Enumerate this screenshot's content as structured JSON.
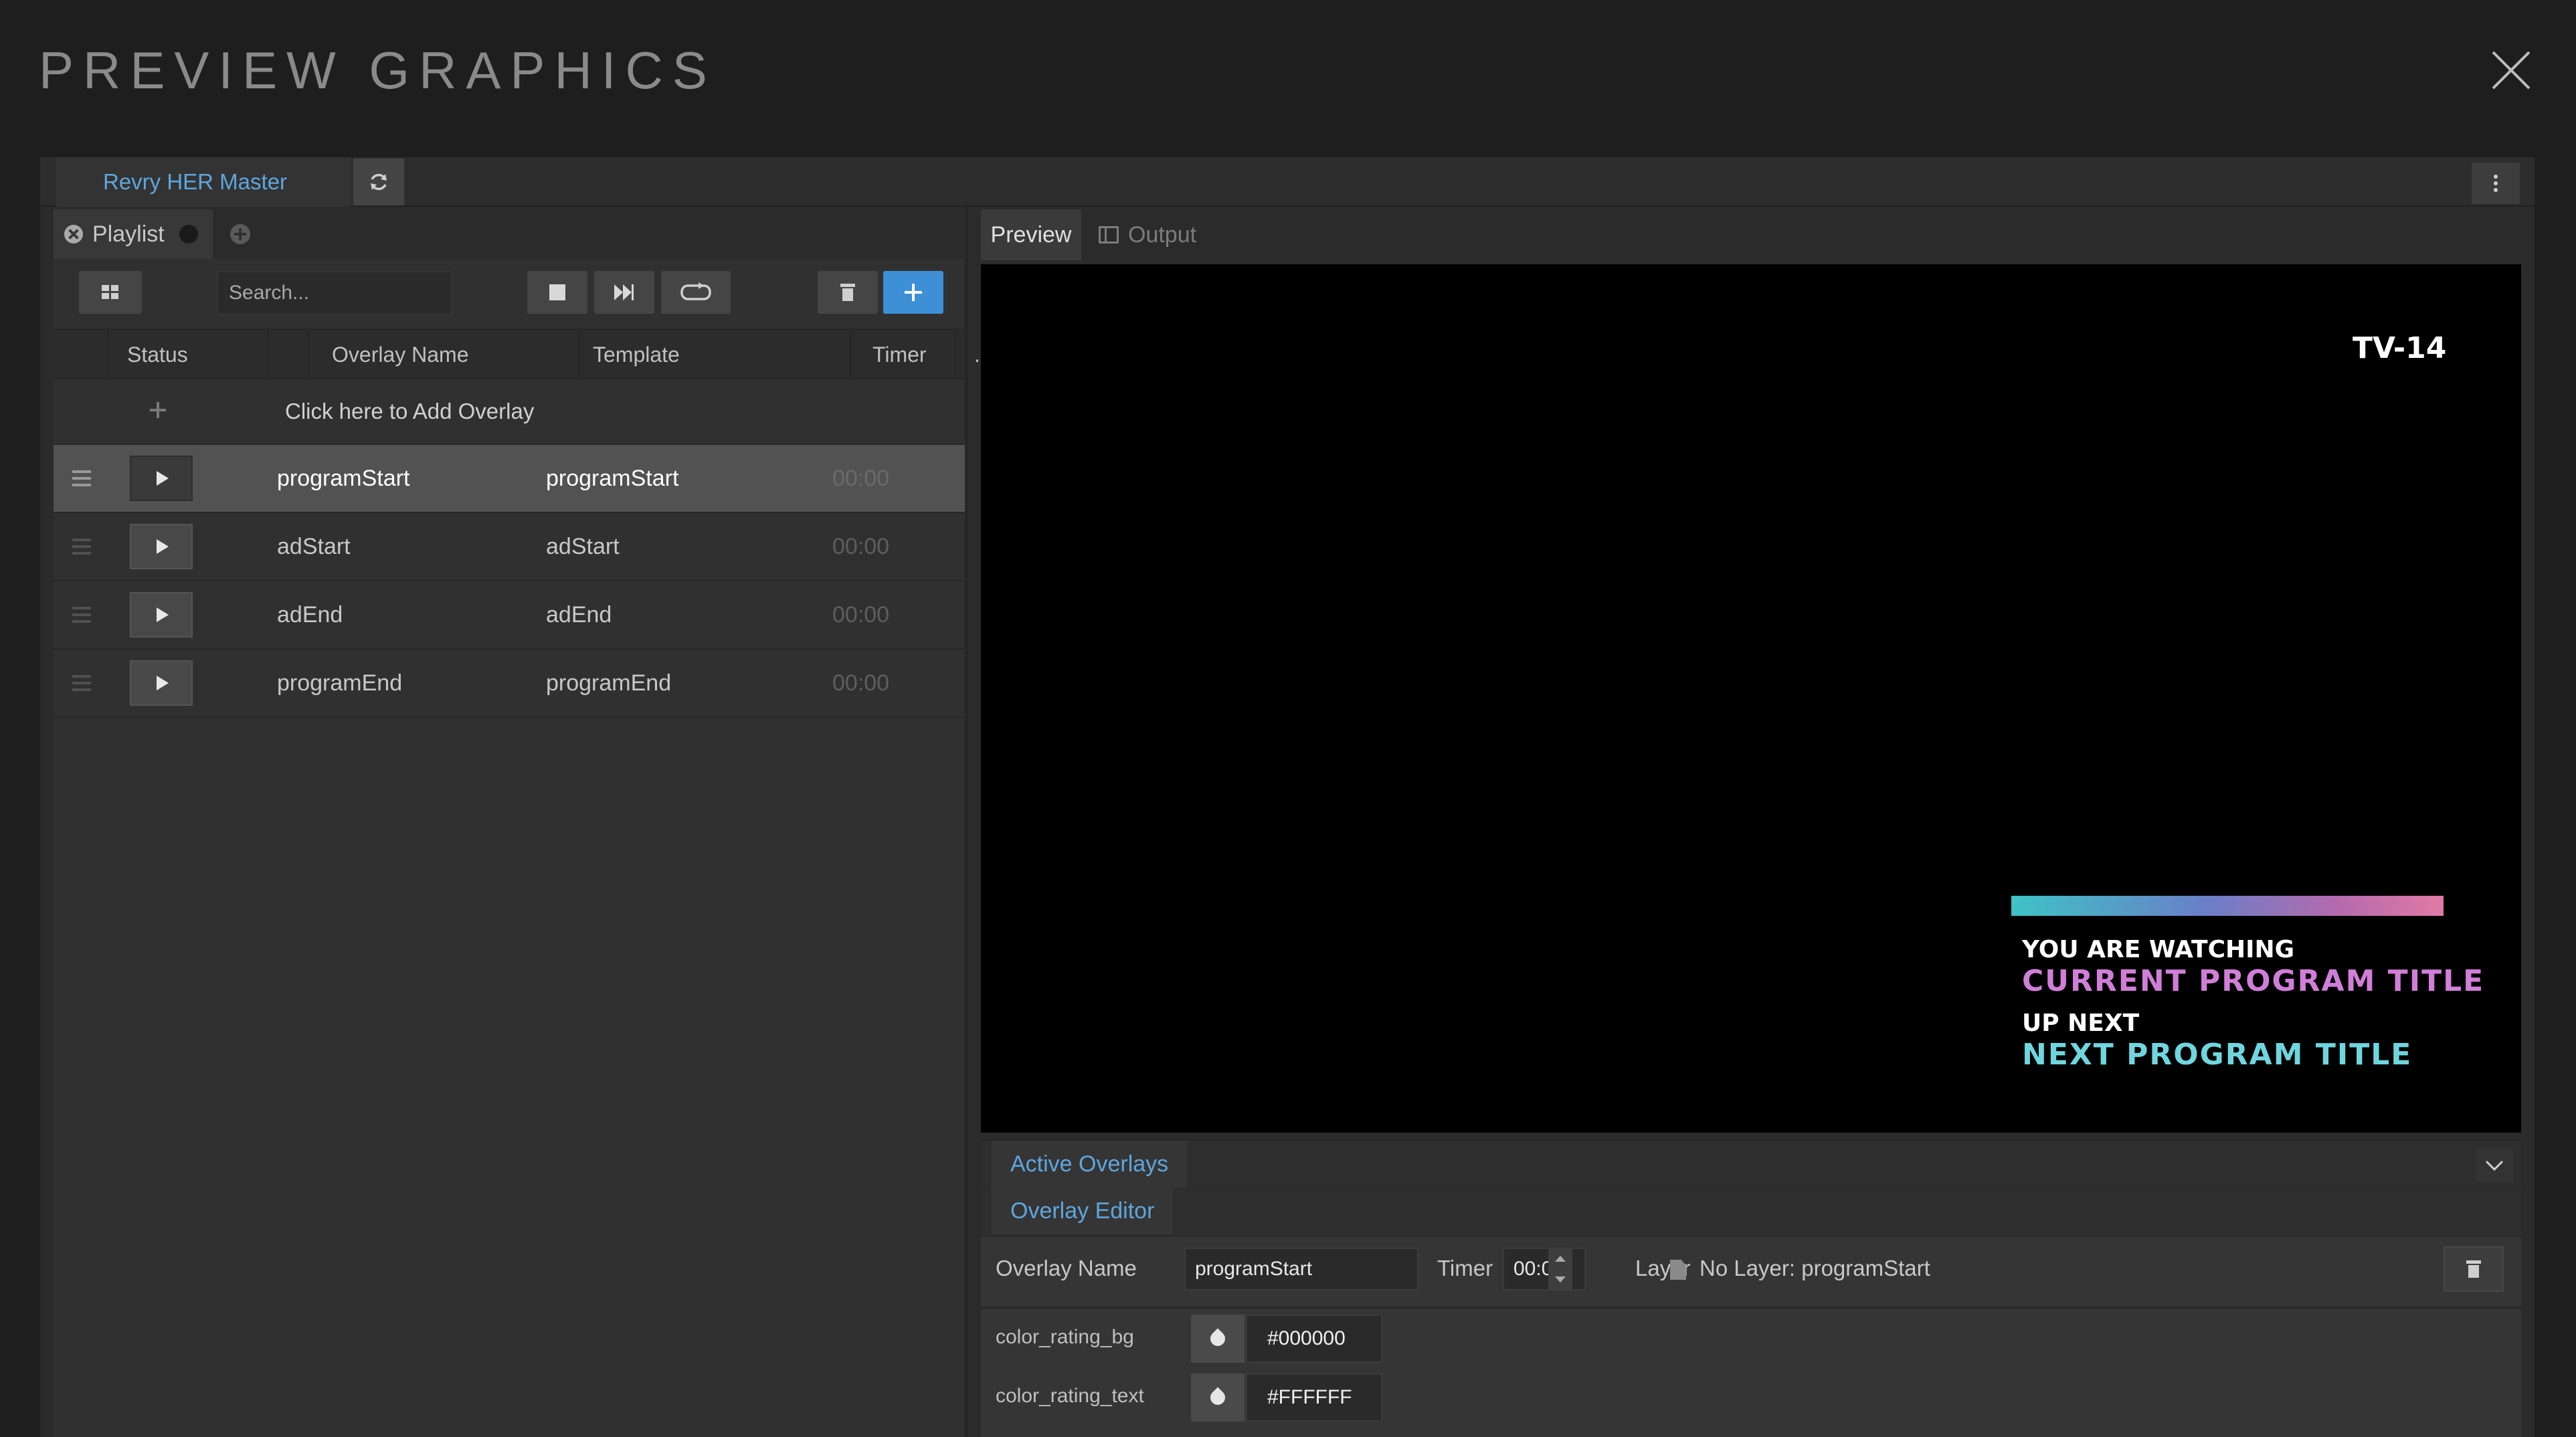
{
  "header": {
    "title": "PREVIEW GRAPHICS"
  },
  "topbar": {
    "master_tab": "Revry HER Master"
  },
  "playlist": {
    "tab_label": "Playlist",
    "search_placeholder": "Search...",
    "columns": {
      "status": "Status",
      "overlay_name": "Overlay Name",
      "template": "Template",
      "timer": "Timer",
      "more": "..."
    },
    "add_overlay": "Click here to Add Overlay",
    "rows": [
      {
        "name": "programStart",
        "template": "programStart",
        "timer": "00:00",
        "selected": true
      },
      {
        "name": "adStart",
        "template": "adStart",
        "timer": "00:00",
        "selected": false
      },
      {
        "name": "adEnd",
        "template": "adEnd",
        "timer": "00:00",
        "selected": false
      },
      {
        "name": "programEnd",
        "template": "programEnd",
        "timer": "00:00",
        "selected": false
      }
    ]
  },
  "preview": {
    "tab_preview": "Preview",
    "tab_output": "Output",
    "rating": "TV-14",
    "overlay": {
      "watching_label": "YOU ARE WATCHING",
      "current_title": "CURRENT PROGRAM TITLE",
      "next_label": "UP NEXT",
      "next_title": "NEXT PROGRAM TITLE",
      "current_color": "#d17ed8",
      "next_color": "#6fd6df"
    }
  },
  "active_overlays": {
    "label": "Active Overlays"
  },
  "overlay_editor": {
    "label": "Overlay Editor",
    "name_label": "Overlay Name",
    "name_value": "programStart",
    "timer_label": "Timer",
    "timer_value": "00:00",
    "layer_label": "Layer",
    "layer_value": "No Layer: programStart",
    "props": [
      {
        "key": "color_rating_bg",
        "value": "#000000"
      },
      {
        "key": "color_rating_text",
        "value": "#FFFFFF"
      }
    ]
  },
  "colors": {
    "accent_blue": "#5ea6de",
    "add_button": "#3d8fd6"
  }
}
